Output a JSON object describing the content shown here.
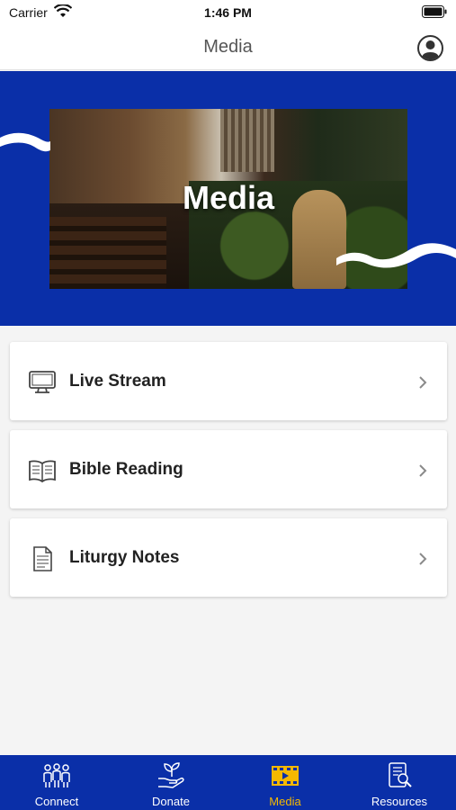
{
  "status_bar": {
    "carrier": "Carrier",
    "time": "1:46 PM"
  },
  "nav": {
    "title": "Media"
  },
  "hero": {
    "title": "Media"
  },
  "menu": {
    "items": [
      {
        "label": "Live Stream",
        "icon": "monitor-icon"
      },
      {
        "label": "Bible Reading",
        "icon": "open-book-icon"
      },
      {
        "label": "Liturgy Notes",
        "icon": "document-icon"
      }
    ]
  },
  "tabs": [
    {
      "label": "Connect",
      "icon": "people-icon",
      "active": false
    },
    {
      "label": "Donate",
      "icon": "hand-plant-icon",
      "active": false
    },
    {
      "label": "Media",
      "icon": "film-icon",
      "active": true
    },
    {
      "label": "Resources",
      "icon": "tablet-search-icon",
      "active": false
    }
  ],
  "colors": {
    "brand_blue": "#0a2fa8",
    "active_tab": "#f5b800",
    "background": "#f4f4f4"
  }
}
